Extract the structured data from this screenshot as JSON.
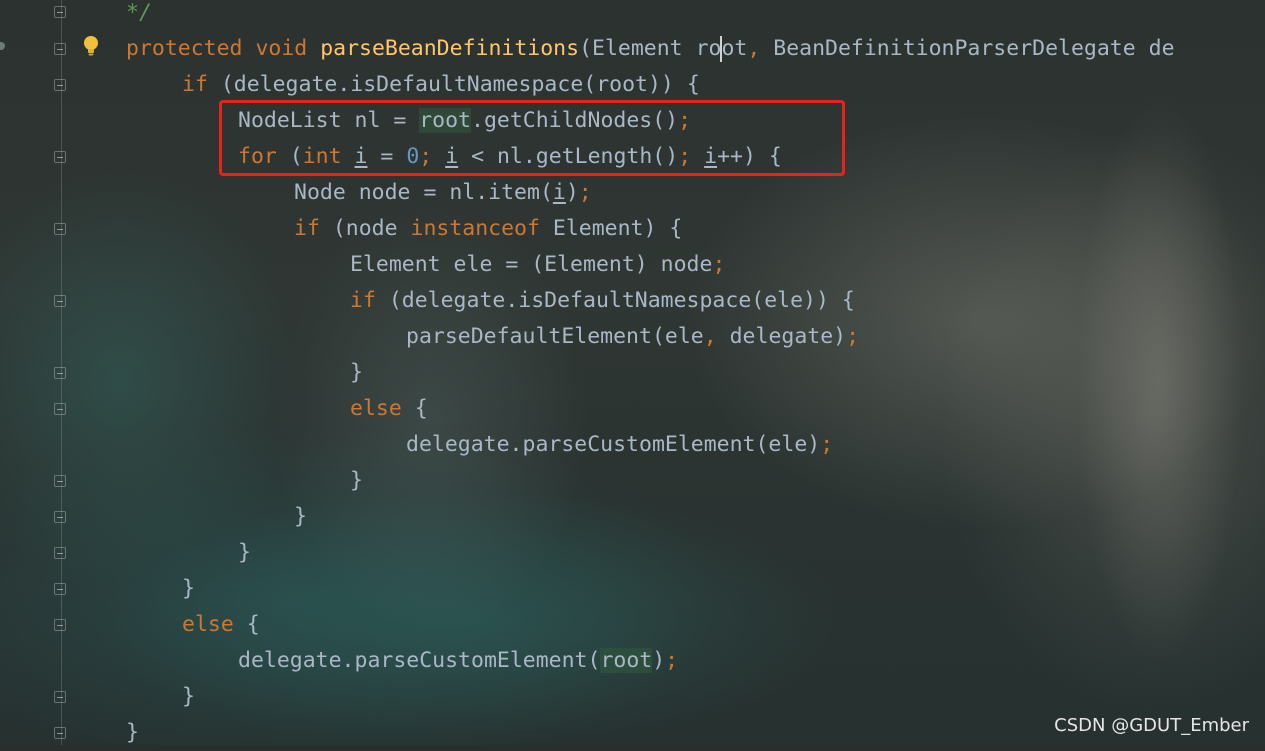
{
  "watermark": "CSDN @GDUT_Ember",
  "colors": {
    "keyword": "#cc7832",
    "method": "#ffc66d",
    "number": "#6897bb",
    "comment": "#629755",
    "default_text": "#a9b7c6",
    "highlight_box": "#e8231d"
  },
  "icons": {
    "gutter_hint": "lightbulb-icon",
    "fold_marker": "fold-marker-icon"
  },
  "code": {
    "l0": {
      "comment": "*/"
    },
    "l1": {
      "kw1": "protected",
      "kw2": "void",
      "method": "parseBeanDefinitions",
      "p1": "(Element ",
      "root_a": "ro",
      "root_b": "ot",
      "comma": ",",
      "p2": " BeanDefinitionParserDelegate de"
    },
    "l2": {
      "kw": "if",
      "text": " (delegate.isDefaultNamespace(root)) {"
    },
    "l3": {
      "a": "NodeList nl = ",
      "hl": "root",
      "b": ".getChildNodes()",
      "semi": ";"
    },
    "l4": {
      "kw1": "for",
      "p1": " (",
      "kw2": "int",
      "sp": " ",
      "var1": "i",
      "p2": " = ",
      "num": "0",
      "semi1": ";",
      "sp2": " ",
      "var2": "i",
      "p3": " < nl.getLength()",
      "semi2": ";",
      "sp3": " ",
      "var3": "i",
      "p4": "++) {"
    },
    "l5": {
      "a": "Node node = nl.item(",
      "var": "i",
      "b": ")",
      "semi": ";"
    },
    "l6": {
      "kw1": "if",
      "a": " (node ",
      "kw2": "instanceof",
      "b": " Element) {"
    },
    "l7": {
      "a": "Element ele = (Element) node",
      "semi": ";"
    },
    "l8": {
      "kw": "if",
      "a": " (delegate.isDefaultNamespace(ele)) {"
    },
    "l9": {
      "a": "parseDefaultElement(ele",
      "comma": ",",
      "b": " delegate)",
      "semi": ";"
    },
    "l10": {
      "a": "}"
    },
    "l11": {
      "kw": "else",
      "a": " {"
    },
    "l12": {
      "a": "delegate.parseCustomElement(ele)",
      "semi": ";"
    },
    "l13": {
      "a": "}"
    },
    "l14": {
      "a": "}"
    },
    "l15": {
      "a": "}"
    },
    "l16": {
      "a": "}"
    },
    "l17": {
      "kw": "else",
      "a": " {"
    },
    "l18": {
      "a": "delegate.parseCustomElement(",
      "hl": "root",
      "b": ")",
      "semi": ";"
    },
    "l19": {
      "a": "}"
    },
    "l20": {
      "a": "}"
    }
  }
}
